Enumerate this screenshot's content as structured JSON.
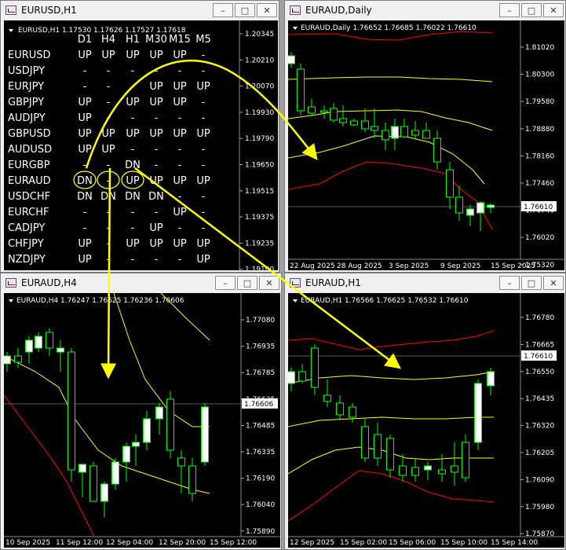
{
  "windows": {
    "eurusd_h1": {
      "title": "EURUSD,H1",
      "info": "EURUSD,H1  1.17530 1.17626 1.17527 1.17618"
    },
    "euraud_daily": {
      "title": "EURAUD,Daily",
      "info": "EURAUD,Daily  1.76652 1.76685 1.76022 1.76610"
    },
    "euraud_h4": {
      "title": "EURAUD,H4",
      "info": "EURAUD,H4  1.76247 1.76625 1.76236 1.76606"
    },
    "euraud_h1": {
      "title": "EURAUD,H1",
      "info": "EURAUD,H1  1.76566 1.76625 1.76532 1.76610"
    }
  },
  "window_buttons": {
    "minimize": "–",
    "maximize": "□",
    "close": "✕"
  },
  "dashboard": {
    "columns": [
      "D1",
      "H4",
      "H1",
      "M30",
      "M15",
      "M5"
    ],
    "rows": [
      {
        "pair": "EURUSD",
        "cells": [
          "UP",
          "UP",
          "UP",
          "UP",
          "UP",
          "-"
        ]
      },
      {
        "pair": "USDJPY",
        "cells": [
          "-",
          "-",
          "-",
          "-",
          "-",
          "-"
        ]
      },
      {
        "pair": "EURJPY",
        "cells": [
          "-",
          "-",
          "-",
          "UP",
          "UP",
          "UP"
        ]
      },
      {
        "pair": "GBPJPY",
        "cells": [
          "UP",
          "-",
          "UP",
          "UP",
          "UP",
          "-"
        ]
      },
      {
        "pair": "AUDJPY",
        "cells": [
          "UP",
          "-",
          "-",
          "-",
          "-",
          "-"
        ]
      },
      {
        "pair": "GBPUSD",
        "cells": [
          "UP",
          "UP",
          "UP",
          "UP",
          "UP",
          "UP"
        ]
      },
      {
        "pair": "AUDUSD",
        "cells": [
          "UP",
          "UP",
          "-",
          "-",
          "-",
          "-"
        ]
      },
      {
        "pair": "EURGBP",
        "cells": [
          "-",
          "-",
          "DN",
          "-",
          "-",
          "-"
        ]
      },
      {
        "pair": "EURAUD",
        "cells": [
          "DN",
          "-",
          "UP",
          "UP",
          "UP",
          "UP"
        ]
      },
      {
        "pair": "USDCHF",
        "cells": [
          "DN",
          "DN",
          "DN",
          "DN",
          "-",
          "-"
        ]
      },
      {
        "pair": "EURCHF",
        "cells": [
          "-",
          "-",
          "-",
          "-",
          "UP",
          "-"
        ]
      },
      {
        "pair": "CADJPY",
        "cells": [
          "-",
          "-",
          "-",
          "UP",
          "-",
          "-"
        ]
      },
      {
        "pair": "CHFJPY",
        "cells": [
          "UP",
          "-",
          "UP",
          "UP",
          "UP",
          "UP"
        ]
      },
      {
        "pair": "NZDJPY",
        "cells": [
          "UP",
          "-",
          "-",
          "-",
          "-",
          "UP"
        ]
      }
    ],
    "price_axis": [
      "1.20345",
      "1.20210",
      "1.20070",
      "1.19930",
      "1.19790",
      "1.19650",
      "1.19515",
      "1.19375",
      "1.19235",
      "1.19100"
    ]
  },
  "daily_axis": {
    "prices": [
      "1.81020",
      "1.80300",
      "1.79580",
      "1.78880",
      "1.78160",
      "1.77460",
      "1.76740",
      "1.76020",
      "1.75320"
    ],
    "current": "1.76610",
    "dates": [
      "22 Aug 2025",
      "28 Aug 2025",
      "3 Sep 2025",
      "9 Sep 2025",
      "15 Sep 2025"
    ]
  },
  "h4_axis": {
    "prices": [
      "1.77080",
      "1.76935",
      "1.76785",
      "1.76625",
      "1.76485",
      "1.76335",
      "1.76190",
      "1.76040",
      "1.75890"
    ],
    "current": "1.76606",
    "dates": [
      "10 Sep 2025",
      "11 Sep 12:00",
      "12 Sep 04:00",
      "12 Sep 20:00",
      "15 Sep 12:00"
    ]
  },
  "h1_axis": {
    "prices": [
      "1.76780",
      "1.76665",
      "1.76550",
      "1.76435",
      "1.76320",
      "1.76205",
      "1.76090",
      "1.75980",
      "1.75870"
    ],
    "current": "1.76610",
    "dates": [
      "12 Sep 2025",
      "15 Sep 02:00",
      "15 Sep 06:00",
      "15 Sep 10:00",
      "15 Sep 14:00"
    ]
  },
  "colors": {
    "up": "#ffffff",
    "bg": "#000000",
    "annotation": "#ffff00",
    "band_outer": "#ff0000",
    "band_inner": "#ffff00"
  }
}
